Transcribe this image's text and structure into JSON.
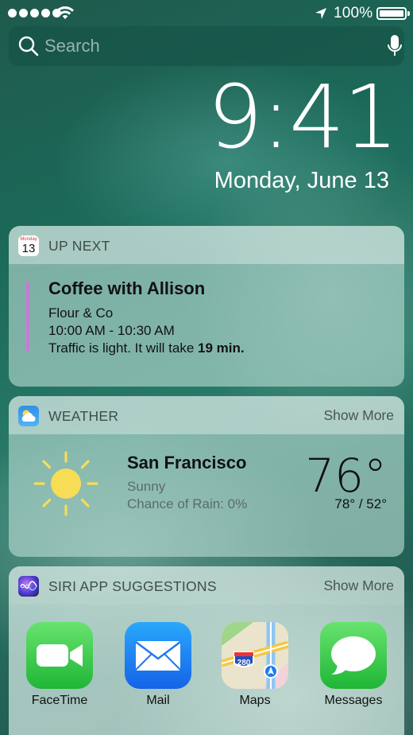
{
  "status_bar": {
    "battery_text": "100%"
  },
  "search": {
    "placeholder": "Search"
  },
  "clock": {
    "time": "9:41",
    "date": "Monday, June 13"
  },
  "up_next": {
    "title": "UP NEXT",
    "icon": {
      "month": "Monday",
      "day": "13"
    },
    "event": {
      "title": "Coffee with Allison",
      "location": "Flour & Co",
      "time": "10:00 AM - 10:30 AM",
      "traffic_prefix": "Traffic is light. It will take ",
      "traffic_duration": "19 min.",
      "accent_color": "#c77ad6"
    }
  },
  "weather": {
    "title": "WEATHER",
    "show_more": "Show More",
    "city": "San Francisco",
    "condition": "Sunny",
    "rain": "Chance of Rain: 0%",
    "temp": "76°",
    "range": "78° / 52°",
    "condition_icon": "sun-icon"
  },
  "siri": {
    "title": "SIRI APP SUGGESTIONS",
    "show_more": "Show More",
    "apps": [
      {
        "label": "FaceTime",
        "icon": "facetime-icon"
      },
      {
        "label": "Mail",
        "icon": "mail-icon"
      },
      {
        "label": "Maps",
        "icon": "maps-icon",
        "road_sign": "280"
      },
      {
        "label": "Messages",
        "icon": "messages-icon"
      }
    ]
  }
}
